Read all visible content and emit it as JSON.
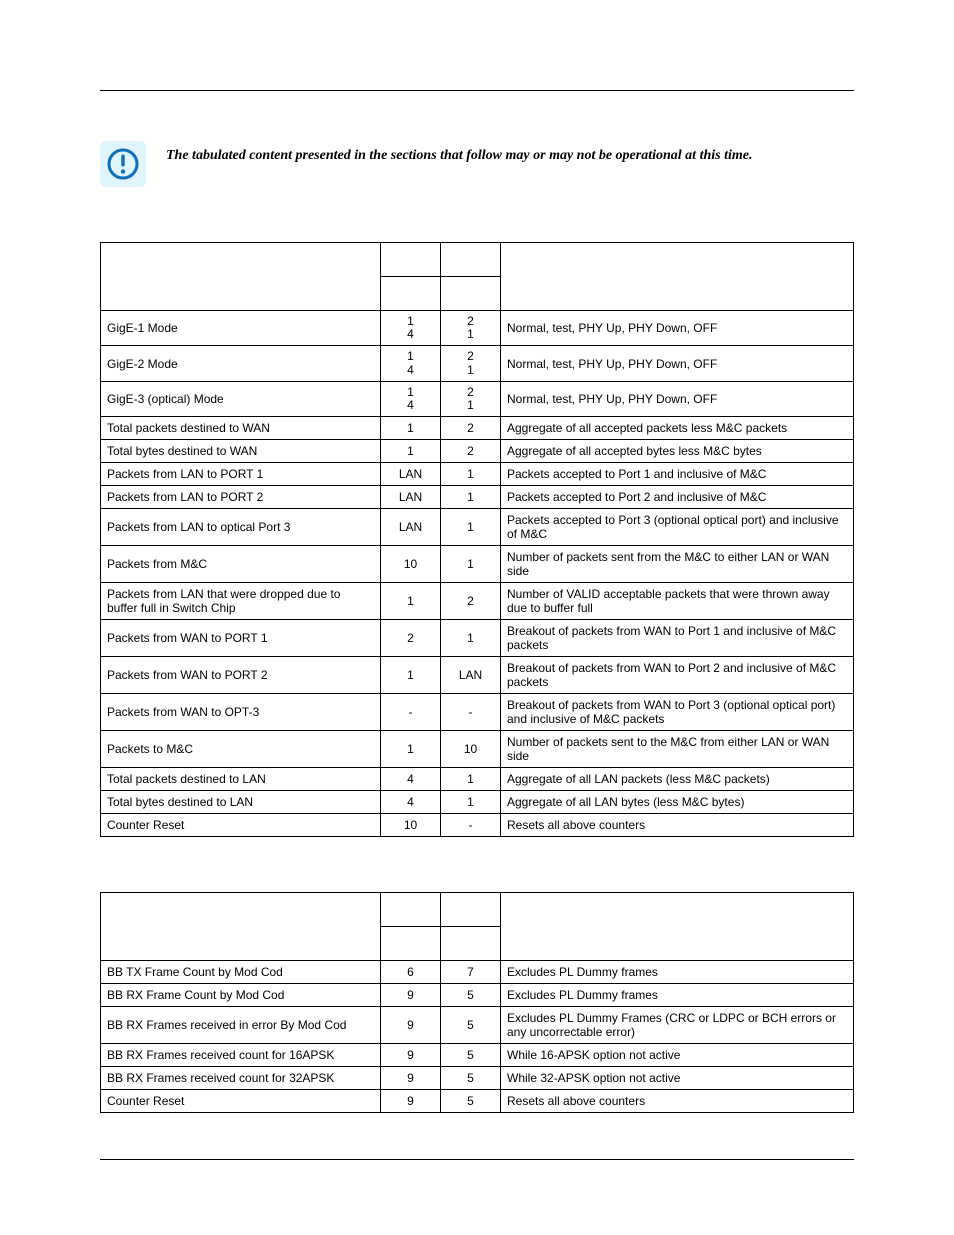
{
  "notice": "The tabulated content presented in the sections that follow may or may not be operational at this time.",
  "table1": {
    "rows": [
      {
        "label": "GigE-1 Mode",
        "c2a": "1",
        "c2b": "4",
        "c3a": "2",
        "c3b": "1",
        "desc": "Normal, test, PHY Up, PHY Down, OFF"
      },
      {
        "label": "GigE-2 Mode",
        "c2a": "1",
        "c2b": "4",
        "c3a": "2",
        "c3b": "1",
        "desc": "Normal, test, PHY Up, PHY Down, OFF"
      },
      {
        "label": "GigE-3 (optical) Mode",
        "c2a": "1",
        "c2b": "4",
        "c3a": "2",
        "c3b": "1",
        "desc": "Normal, test, PHY Up, PHY Down, OFF"
      },
      {
        "label": "Total packets destined to WAN",
        "c2a": "1",
        "c3a": "2",
        "desc": "Aggregate of all accepted packets less M&C packets"
      },
      {
        "label": "Total bytes destined to WAN",
        "c2a": "1",
        "c3a": "2",
        "desc": "Aggregate of all accepted bytes less M&C bytes"
      },
      {
        "label": "Packets from LAN to PORT 1",
        "c2a": "LAN",
        "c3a": "1",
        "desc": "Packets accepted to Port 1 and inclusive of M&C"
      },
      {
        "label": "Packets from LAN to PORT 2",
        "c2a": "LAN",
        "c3a": "1",
        "desc": "Packets accepted to Port 2 and inclusive of M&C"
      },
      {
        "label": "Packets from LAN to optical Port 3",
        "c2a": "LAN",
        "c3a": "1",
        "desc": "Packets accepted to Port 3 (optional optical port) and inclusive of M&C"
      },
      {
        "label": "Packets from M&C",
        "c2a": "10",
        "c3a": "1",
        "desc": "Number of packets sent from the M&C to either LAN or WAN side"
      },
      {
        "label": "Packets from LAN that were dropped due to buffer full in Switch Chip",
        "c2a": "1",
        "c3a": "2",
        "desc": "Number of VALID acceptable packets that were thrown away due to buffer full"
      },
      {
        "label": "Packets from WAN to PORT 1",
        "c2a": "2",
        "c3a": "1",
        "desc": "Breakout of packets from WAN to Port 1 and inclusive of M&C packets"
      },
      {
        "label": "Packets from WAN to PORT 2",
        "c2a": "1",
        "c3a": "LAN",
        "desc": "Breakout of packets from WAN to Port 2 and inclusive of M&C packets"
      },
      {
        "label": "Packets from WAN to OPT-3",
        "c2a": "-",
        "c3a": "-",
        "desc": "Breakout of packets from WAN to Port 3 (optional optical port) and inclusive of M&C packets"
      },
      {
        "label": "Packets to M&C",
        "c2a": "1",
        "c3a": "10",
        "desc": "Number of packets sent to the M&C from either LAN or WAN side"
      },
      {
        "label": "Total packets destined to LAN",
        "c2a": "4",
        "c3a": "1",
        "desc": "Aggregate of all LAN packets (less M&C packets)"
      },
      {
        "label": "Total bytes destined to LAN",
        "c2a": "4",
        "c3a": "1",
        "desc": "Aggregate of all LAN bytes (less M&C bytes)"
      },
      {
        "label": "Counter Reset",
        "c2a": "10",
        "c3a": "-",
        "desc": "Resets all above counters"
      }
    ]
  },
  "table2": {
    "rows": [
      {
        "label": "BB TX Frame Count by Mod Cod",
        "c2": "6",
        "c3": "7",
        "desc": "Excludes PL Dummy frames"
      },
      {
        "label": "BB RX Frame Count by Mod Cod",
        "c2": "9",
        "c3": "5",
        "desc": "Excludes PL Dummy frames"
      },
      {
        "label": "BB RX Frames received in error By Mod Cod",
        "c2": "9",
        "c3": "5",
        "desc": "Excludes PL Dummy Frames (CRC or LDPC or BCH errors or any uncorrectable error)"
      },
      {
        "label": "BB RX Frames received count for 16APSK",
        "c2": "9",
        "c3": "5",
        "desc": "While 16-APSK option not active"
      },
      {
        "label": "BB RX Frames received count for 32APSK",
        "c2": "9",
        "c3": "5",
        "desc": "While 32-APSK option not active"
      },
      {
        "label": "Counter Reset",
        "c2": "9",
        "c3": "5",
        "desc": "Resets all above counters"
      }
    ]
  }
}
